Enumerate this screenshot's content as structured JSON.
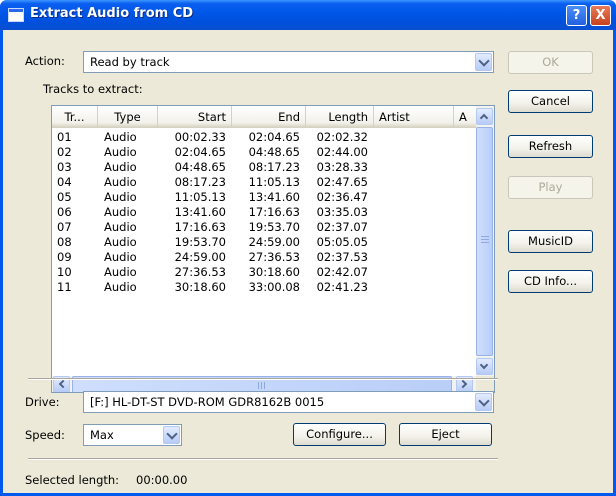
{
  "window": {
    "title": "Extract Audio from CD",
    "help_glyph": "?",
    "close_glyph": "X"
  },
  "action": {
    "label": "Action:",
    "value": "Read by track"
  },
  "tracks": {
    "label": "Tracks to extract:",
    "columns": [
      "Tr...",
      "Type",
      "Start",
      "End",
      "Length",
      "Artist",
      "A"
    ],
    "rows": [
      [
        "01",
        "Audio",
        "00:02.33",
        "02:04.65",
        "02:02.32"
      ],
      [
        "02",
        "Audio",
        "02:04.65",
        "04:48.65",
        "02:44.00"
      ],
      [
        "03",
        "Audio",
        "04:48.65",
        "08:17.23",
        "03:28.33"
      ],
      [
        "04",
        "Audio",
        "08:17.23",
        "11:05.13",
        "02:47.65"
      ],
      [
        "05",
        "Audio",
        "11:05.13",
        "13:41.60",
        "02:36.47"
      ],
      [
        "06",
        "Audio",
        "13:41.60",
        "17:16.63",
        "03:35.03"
      ],
      [
        "07",
        "Audio",
        "17:16.63",
        "19:53.70",
        "02:37.07"
      ],
      [
        "08",
        "Audio",
        "19:53.70",
        "24:59.00",
        "05:05.05"
      ],
      [
        "09",
        "Audio",
        "24:59.00",
        "27:36.53",
        "02:37.53"
      ],
      [
        "10",
        "Audio",
        "27:36.53",
        "30:18.60",
        "02:42.07"
      ],
      [
        "11",
        "Audio",
        "30:18.60",
        "33:00.08",
        "02:41.23"
      ]
    ]
  },
  "buttons": {
    "ok": "OK",
    "cancel": "Cancel",
    "refresh": "Refresh",
    "play": "Play",
    "musicid": "MusicID",
    "cdinfo": "CD Info...",
    "configure": "Configure...",
    "eject": "Eject"
  },
  "drive": {
    "label": "Drive:",
    "value": "[F:] HL-DT-ST DVD-ROM GDR8162B 0015"
  },
  "speed": {
    "label": "Speed:",
    "value": "Max"
  },
  "selected": {
    "label": "Selected length:",
    "value": "00:00.00"
  }
}
